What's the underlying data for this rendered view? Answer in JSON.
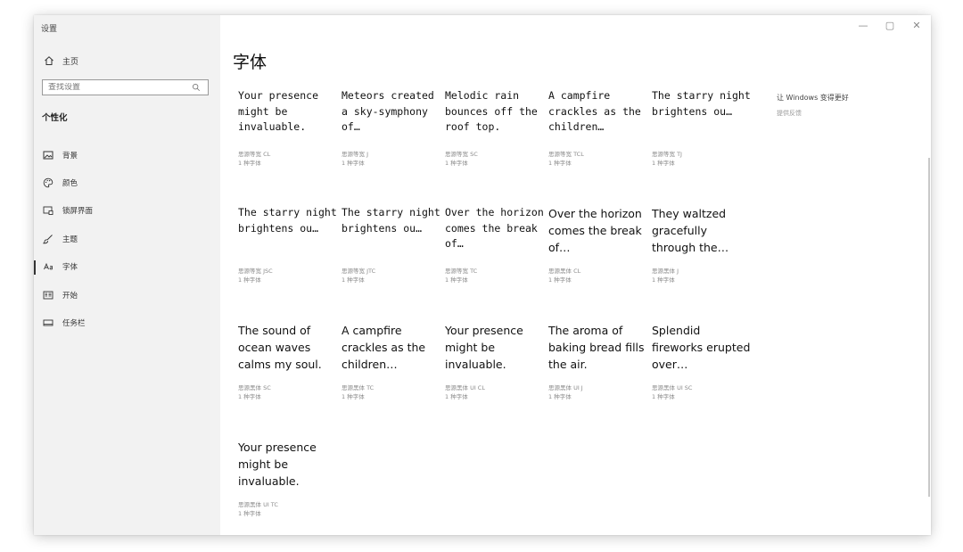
{
  "window": {
    "app_title": "设置",
    "controls": {
      "minimize": "—",
      "maximize": "▢",
      "close": "✕"
    }
  },
  "sidebar": {
    "home_label": "主页",
    "search_placeholder": "查找设置",
    "section_title": "个性化",
    "items": [
      {
        "label": "背景",
        "icon": "image-icon"
      },
      {
        "label": "颜色",
        "icon": "palette-icon"
      },
      {
        "label": "锁屏界面",
        "icon": "lock-screen-icon"
      },
      {
        "label": "主题",
        "icon": "brush-icon"
      },
      {
        "label": "字体",
        "icon": "font-icon",
        "active": true
      },
      {
        "label": "开始",
        "icon": "start-icon"
      },
      {
        "label": "任务栏",
        "icon": "taskbar-icon"
      }
    ]
  },
  "main": {
    "title": "字体",
    "fonts": [
      {
        "preview": "Your presence might be invaluable.",
        "name": "思源等宽 CL",
        "faces": "1 种字体"
      },
      {
        "preview": "Meteors created a sky-symphony of…",
        "name": "思源等宽 J",
        "faces": "1 种字体"
      },
      {
        "preview": "Melodic rain bounces off the roof top.",
        "name": "思源等宽 SC",
        "faces": "1 种字体"
      },
      {
        "preview": "A campfire crackles as the children…",
        "name": "思源等宽 TCL",
        "faces": "1 种字体"
      },
      {
        "preview": "The starry night brightens ou…",
        "name": "思源等宽 TJ",
        "faces": "1 种字体"
      },
      {
        "preview": "The starry night brightens ou…",
        "name": "思源等宽 JSC",
        "faces": "1 种字体"
      },
      {
        "preview": "The starry night brightens ou…",
        "name": "思源等宽 JTC",
        "faces": "1 种字体"
      },
      {
        "preview": "Over the horizon comes the break of…",
        "name": "思源等宽 TC",
        "faces": "1 种字体"
      },
      {
        "preview": "Over the horizon comes the break of…",
        "name": "思源黑体 CL",
        "faces": "1 种字体"
      },
      {
        "preview": "They waltzed gracefully through the…",
        "name": "思源黑体 J",
        "faces": "1 种字体"
      },
      {
        "preview": "The sound of ocean waves calms my soul.",
        "name": "思源黑体 SC",
        "faces": "1 种字体"
      },
      {
        "preview": "A campfire crackles as the children…",
        "name": "思源黑体 TC",
        "faces": "1 种字体"
      },
      {
        "preview": "Your presence might be invaluable.",
        "name": "思源黑体 UI CL",
        "faces": "1 种字体"
      },
      {
        "preview": "The aroma of baking bread fills the air.",
        "name": "思源黑体 UI J",
        "faces": "1 种字体"
      },
      {
        "preview": "Splendid fireworks erupted over…",
        "name": "思源黑体 UI SC",
        "faces": "1 种字体"
      },
      {
        "preview": "Your presence might be invaluable.",
        "name": "思源黑体 UI TC",
        "faces": "1 种字体"
      }
    ],
    "related": {
      "heading": "让 Windows 变得更好",
      "link": "提供反馈"
    }
  }
}
